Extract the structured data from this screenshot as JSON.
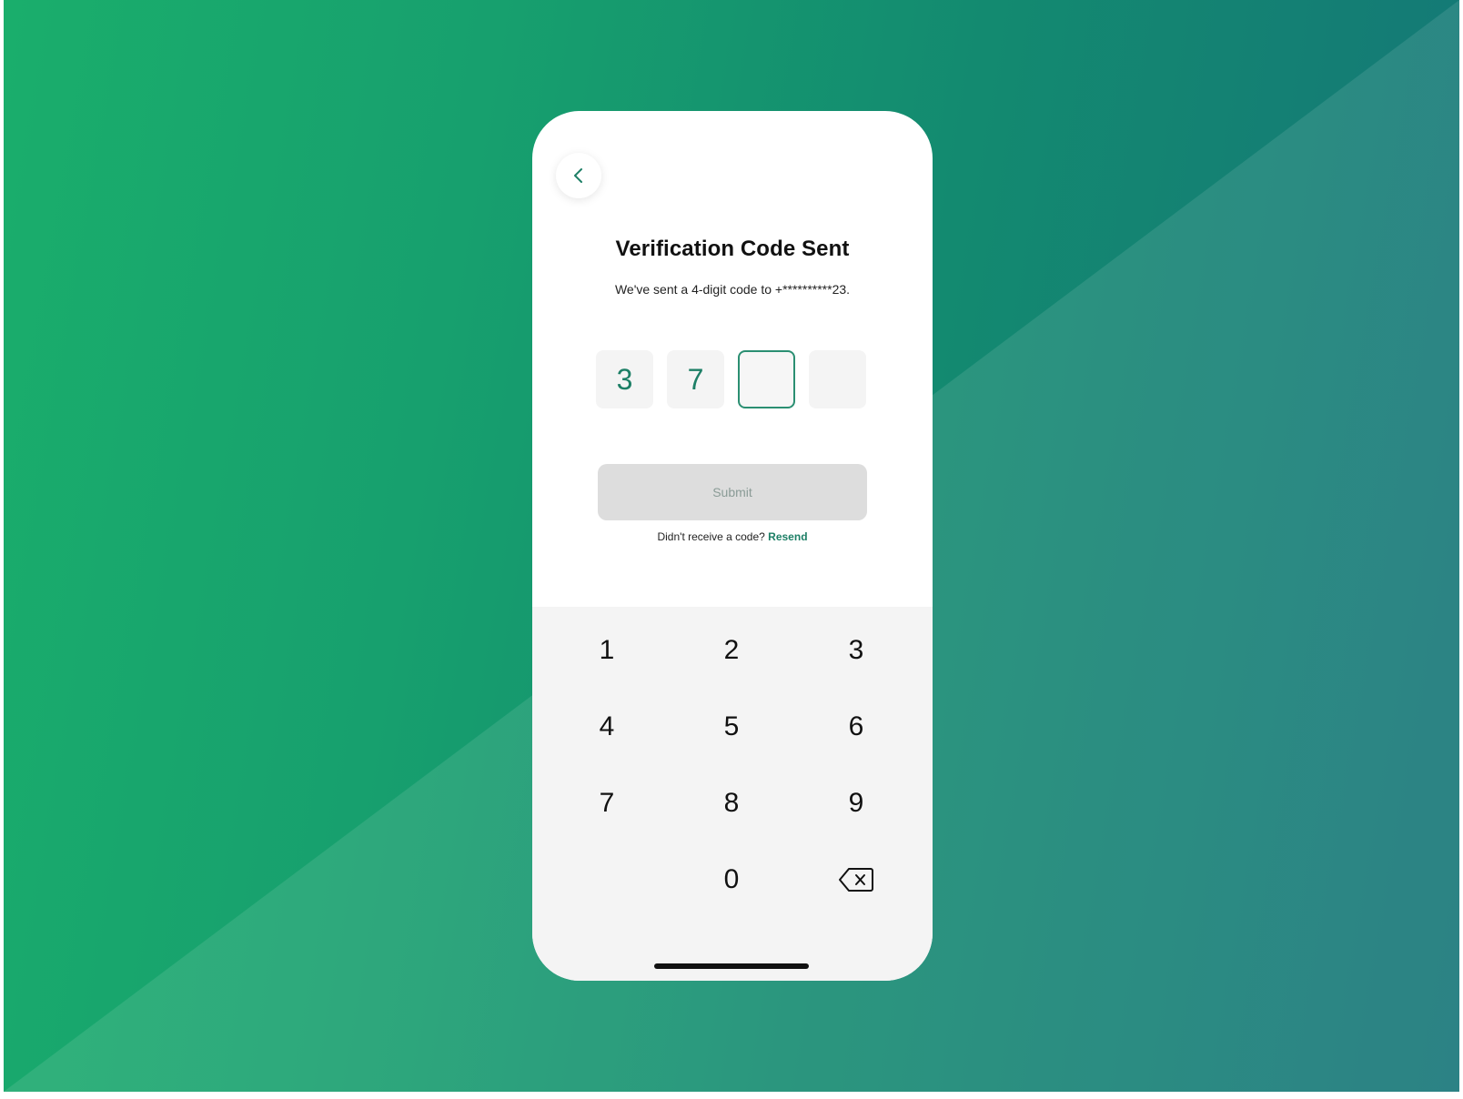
{
  "colors": {
    "accent": "#1d7f66",
    "active_border": "#2b8f72",
    "background_start": "#1aae6c",
    "background_end": "#157478",
    "keypad_bg": "#f4f4f4",
    "submit_disabled_bg": "#dddddd"
  },
  "header": {
    "back_icon": "chevron-left-icon",
    "title": "Verification Code Sent",
    "subtitle": "We've sent a 4-digit code to +**********23."
  },
  "otp": {
    "digits": [
      "3",
      "7",
      "",
      ""
    ],
    "active_index": 2
  },
  "actions": {
    "submit_label": "Submit",
    "resend_prompt": "Didn't receive a code?",
    "resend_label": "Resend"
  },
  "keypad": {
    "keys": [
      "1",
      "2",
      "3",
      "4",
      "5",
      "6",
      "7",
      "8",
      "9",
      "",
      "0",
      "backspace-icon"
    ]
  }
}
